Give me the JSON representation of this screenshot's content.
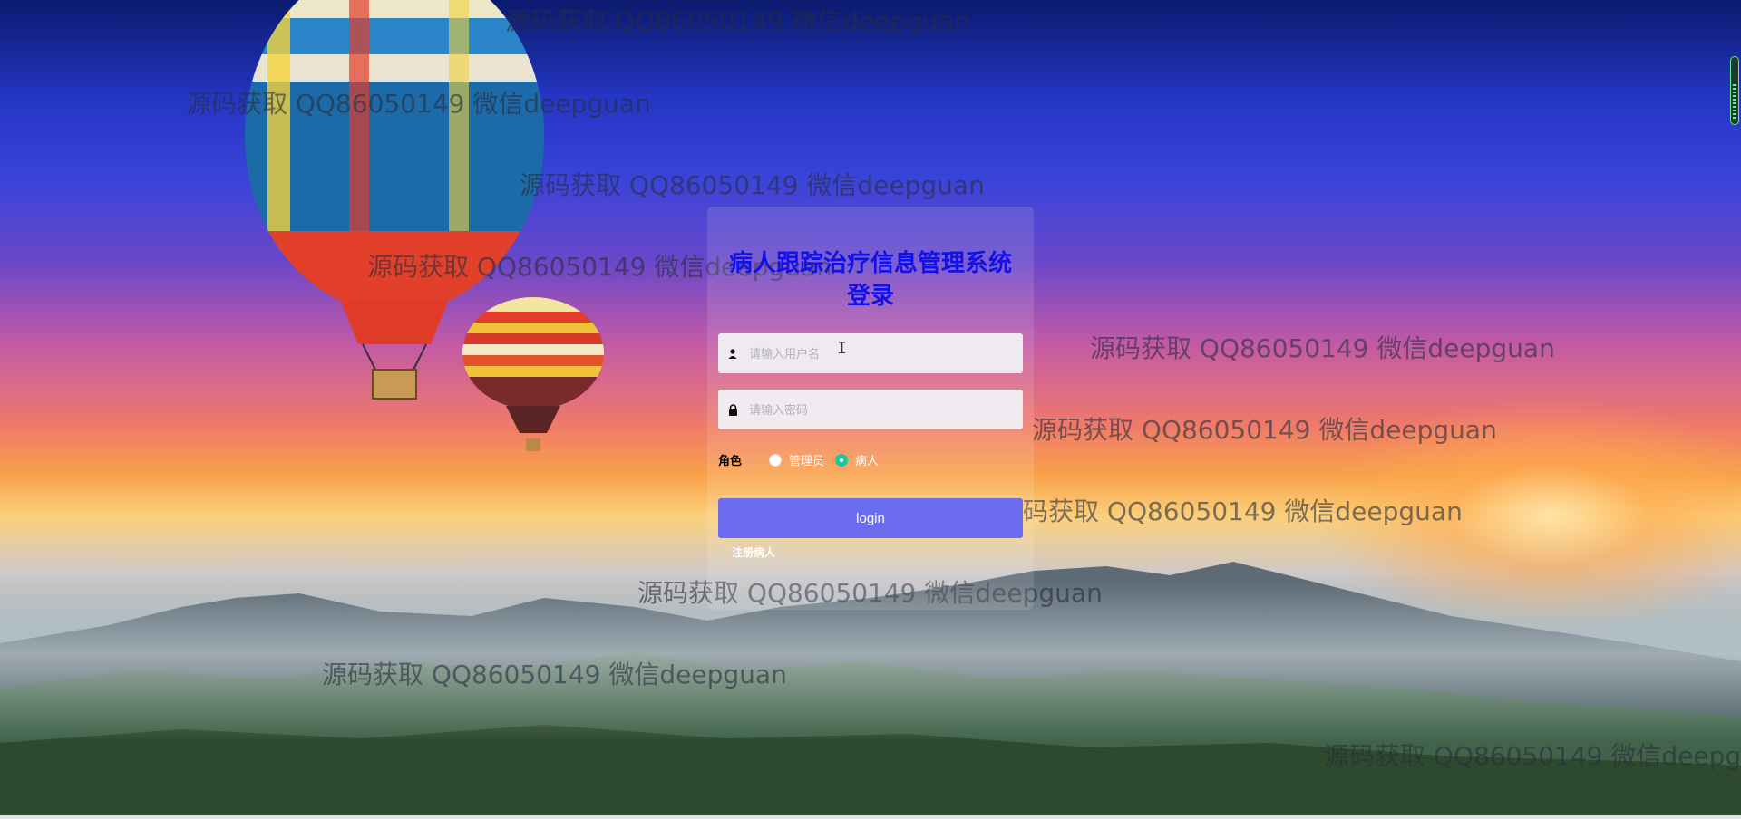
{
  "watermark_text": "源码获取 QQ86050149 微信deepguan",
  "login": {
    "title": "病人跟踪治疗信息管理系统登录",
    "username_placeholder": "请输入用户名",
    "password_placeholder": "请输入密码",
    "role_label": "角色",
    "roles": [
      "管理员",
      "病人"
    ],
    "selected_role": "病人",
    "login_button": "login",
    "register_link": "注册病人"
  },
  "colors": {
    "title": "#1212e8",
    "button": "#6c6cf0",
    "radio_checked": "#1ec6a0"
  },
  "icons": {
    "username": "user-icon",
    "password": "lock-icon"
  }
}
